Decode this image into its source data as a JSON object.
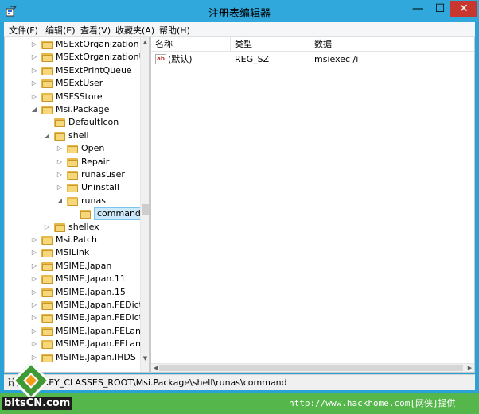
{
  "window": {
    "title": "注册表编辑器"
  },
  "menu": [
    "文件(F)",
    "编辑(E)",
    "查看(V)",
    "收藏夹(A)",
    "帮助(H)"
  ],
  "tree": {
    "items": [
      {
        "label": "MSExtOrganization",
        "indent": 0,
        "arrow": "collapsed"
      },
      {
        "label": "MSExtOrganizationU",
        "indent": 0,
        "arrow": "collapsed"
      },
      {
        "label": "MSExtPrintQueue",
        "indent": 0,
        "arrow": "collapsed"
      },
      {
        "label": "MSExtUser",
        "indent": 0,
        "arrow": "collapsed"
      },
      {
        "label": "MSFSStore",
        "indent": 0,
        "arrow": "collapsed"
      },
      {
        "label": "Msi.Package",
        "indent": 0,
        "arrow": "expanded"
      },
      {
        "label": "DefaultIcon",
        "indent": 1,
        "arrow": "none"
      },
      {
        "label": "shell",
        "indent": 1,
        "arrow": "expanded"
      },
      {
        "label": "Open",
        "indent": 2,
        "arrow": "collapsed"
      },
      {
        "label": "Repair",
        "indent": 2,
        "arrow": "collapsed"
      },
      {
        "label": "runasuser",
        "indent": 2,
        "arrow": "collapsed"
      },
      {
        "label": "Uninstall",
        "indent": 2,
        "arrow": "collapsed"
      },
      {
        "label": "runas",
        "indent": 2,
        "arrow": "expanded"
      },
      {
        "label": "command",
        "indent": 3,
        "arrow": "none",
        "selected": true
      },
      {
        "label": "shellex",
        "indent": 1,
        "arrow": "collapsed"
      },
      {
        "label": "Msi.Patch",
        "indent": 0,
        "arrow": "collapsed"
      },
      {
        "label": "MSILink",
        "indent": 0,
        "arrow": "collapsed"
      },
      {
        "label": "MSIME.Japan",
        "indent": 0,
        "arrow": "collapsed"
      },
      {
        "label": "MSIME.Japan.11",
        "indent": 0,
        "arrow": "collapsed"
      },
      {
        "label": "MSIME.Japan.15",
        "indent": 0,
        "arrow": "collapsed"
      },
      {
        "label": "MSIME.Japan.FEDict",
        "indent": 0,
        "arrow": "collapsed"
      },
      {
        "label": "MSIME.Japan.FEDict.",
        "indent": 0,
        "arrow": "collapsed"
      },
      {
        "label": "MSIME.Japan.FELang",
        "indent": 0,
        "arrow": "collapsed"
      },
      {
        "label": "MSIME.Japan.FELang",
        "indent": 0,
        "arrow": "collapsed"
      },
      {
        "label": "MSIME.Japan.IHDS",
        "indent": 0,
        "arrow": "collapsed"
      }
    ]
  },
  "list": {
    "headers": {
      "name": "名称",
      "type": "类型",
      "data": "数据"
    },
    "rows": [
      {
        "icon": "ab",
        "name": "(默认)",
        "type": "REG_SZ",
        "data": "msiexec /i"
      }
    ]
  },
  "status": {
    "path": "计算机\\HKEY_CLASSES_ROOT\\Msi.Package\\shell\\runas\\command"
  },
  "watermark": {
    "logo": "bitsCN.com",
    "url": "http://www.hackhome.com[网侠]提供"
  }
}
